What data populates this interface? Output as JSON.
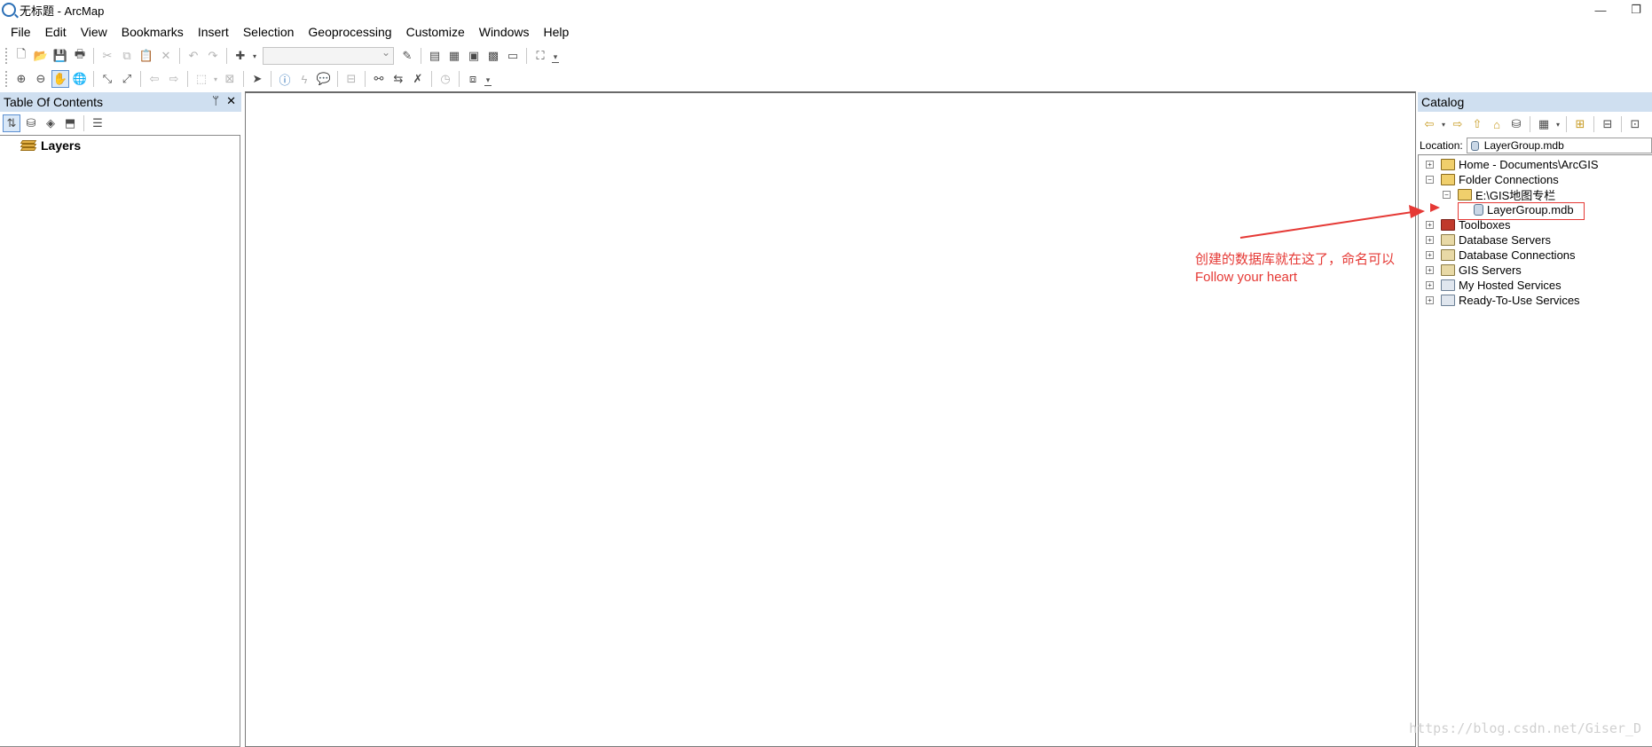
{
  "window": {
    "title": "无标题 - ArcMap",
    "minimize_glyph": "—",
    "restore_glyph": "❐"
  },
  "menu": [
    "File",
    "Edit",
    "View",
    "Bookmarks",
    "Insert",
    "Selection",
    "Geoprocessing",
    "Customize",
    "Windows",
    "Help"
  ],
  "toc": {
    "title": "Table Of Contents",
    "pin_glyph": "ᛘ",
    "close_glyph": "✕",
    "layers_label": "Layers"
  },
  "catalog": {
    "title": "Catalog",
    "location_label": "Location:",
    "location_value": "LayerGroup.mdb",
    "tree": {
      "home": "Home - Documents\\ArcGIS",
      "folder_connections": "Folder Connections",
      "gis_folder": "E:\\GIS地图专栏",
      "layergroup_mdb": "LayerGroup.mdb",
      "toolboxes": "Toolboxes",
      "database_servers": "Database Servers",
      "database_connections": "Database Connections",
      "gis_servers": "GIS Servers",
      "my_hosted_services": "My Hosted Services",
      "ready_to_use_services": "Ready-To-Use Services"
    }
  },
  "annotation": {
    "line1": "创建的数据库就在这了，命名可以",
    "line2": "Follow your heart",
    "color": "#e53935"
  },
  "watermark": "https://blog.csdn.net/Giser_D",
  "icons": {
    "expand": "+",
    "collapse": "−"
  }
}
